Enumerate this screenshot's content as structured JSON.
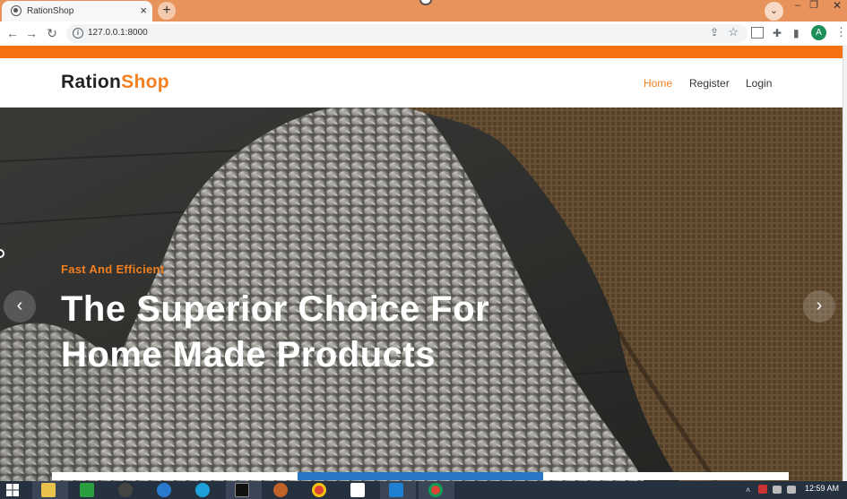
{
  "browser": {
    "tab_title": "RationShop",
    "tab_close": "×",
    "new_tab": "+",
    "tab_menu": "⌄",
    "url": "127.0.0.1:8000",
    "profile_initial": "A",
    "window_controls": {
      "minimize": "–",
      "maximize": "❐",
      "close": "✕"
    },
    "toolbar_icons": {
      "back": "←",
      "forward": "→",
      "reload": "↻",
      "info": "i",
      "share": "⇪",
      "star": "☆",
      "puzzle": "✚",
      "sidebar": "▮",
      "menu": "⋮"
    }
  },
  "site": {
    "logo": {
      "part1": "Ration",
      "part2": "Shop"
    },
    "nav": [
      {
        "label": "Home",
        "active": true
      },
      {
        "label": "Register",
        "active": false
      },
      {
        "label": "Login",
        "active": false
      }
    ]
  },
  "hero": {
    "subtitle": "Fast And Efficient",
    "headline": "The Superior Choice For Home Made Products",
    "prev_arrow": "‹",
    "next_arrow": "›",
    "slide_progress": {
      "slides": 3,
      "active_index": 1
    }
  },
  "taskbar": {
    "clock": "12:59 AM",
    "tray": "˄",
    "icons": [
      "windows-start-icon",
      "file-explorer-icon",
      "store-icon",
      "obs-icon",
      "internet-explorer-icon",
      "edge-icon",
      "terminal-icon",
      "app-icon",
      "chrome-icon",
      "word-icon",
      "vscode-icon",
      "chrome-alt-icon"
    ]
  },
  "colors": {
    "accent_orange": "#f47f1f",
    "strip_orange": "#f5700f",
    "progress_blue": "#2a76c6",
    "tabbar": "#e8935c"
  }
}
